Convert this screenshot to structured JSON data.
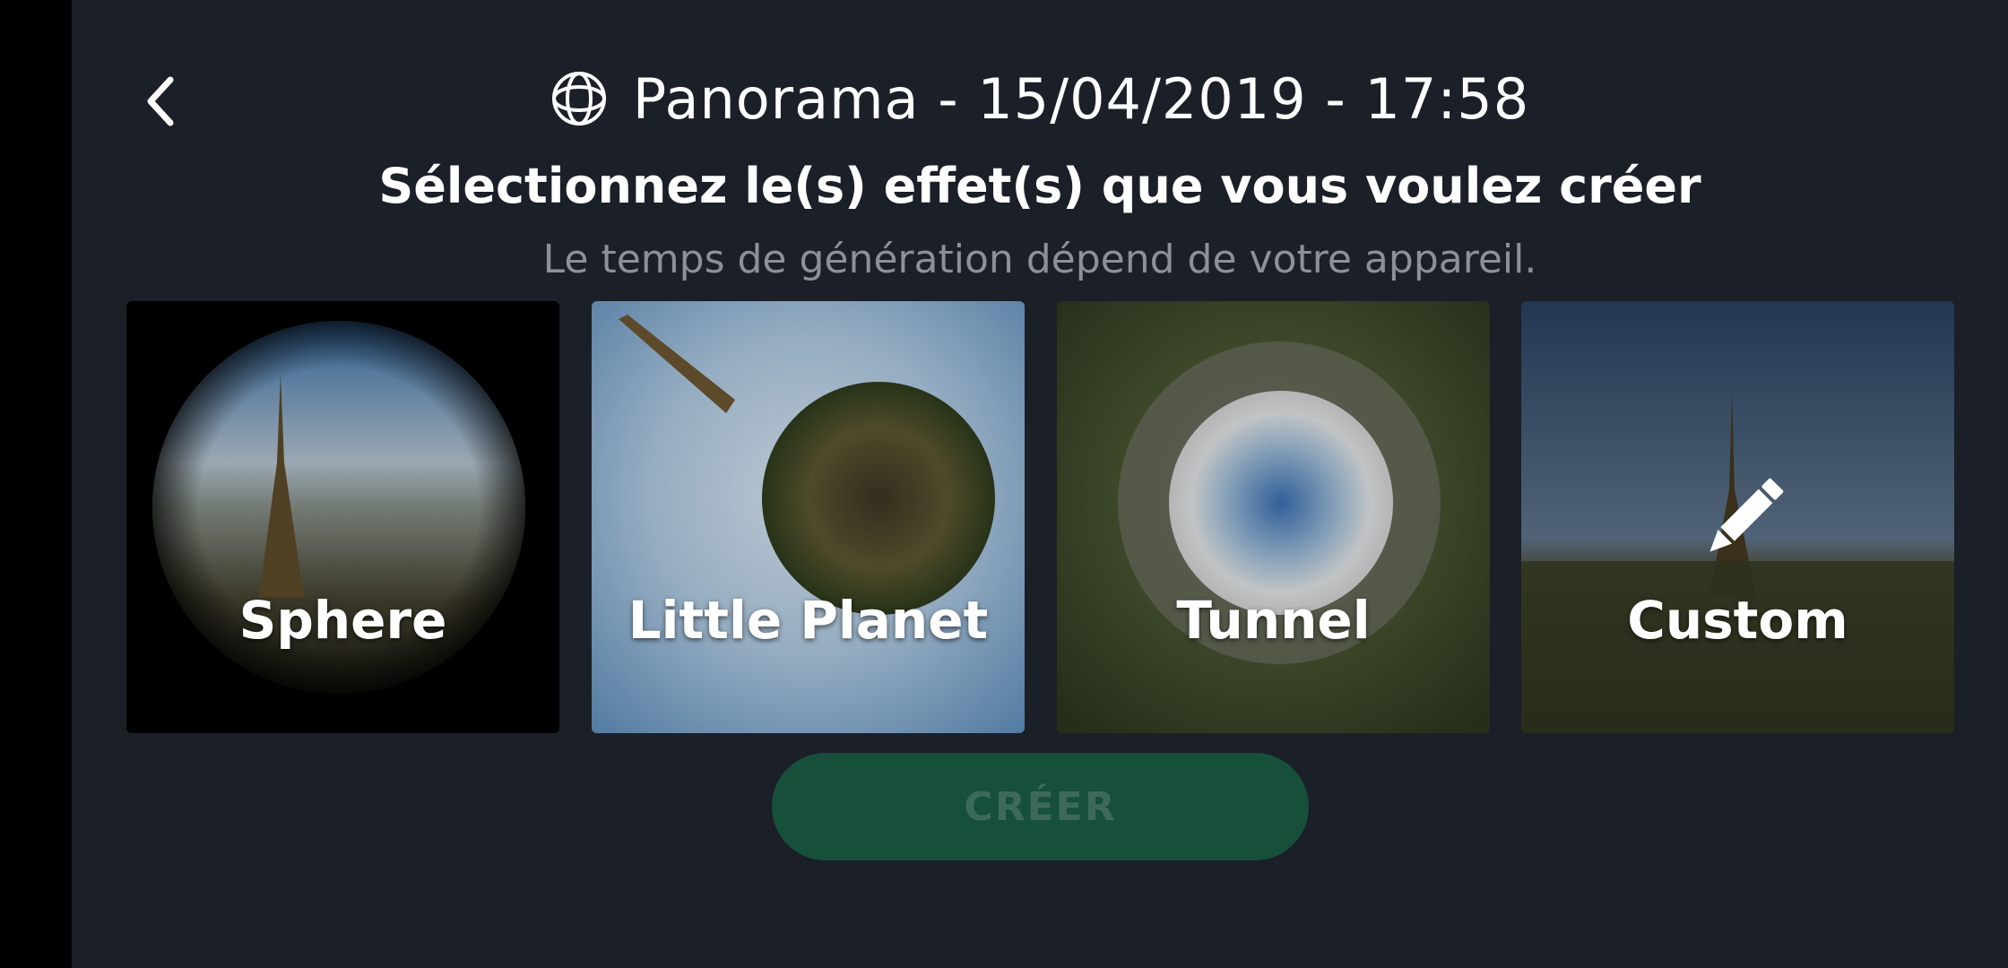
{
  "header": {
    "title": "Panorama - 15/04/2019 - 17:58",
    "back_icon": "chevron-left-icon",
    "title_icon": "globe-icon"
  },
  "heading": "Sélectionnez le(s) effet(s) que vous voulez créer",
  "subheading": "Le temps de génération dépend de votre appareil.",
  "effects": [
    {
      "label": "Sphere"
    },
    {
      "label": "Little Planet"
    },
    {
      "label": "Tunnel"
    },
    {
      "label": "Custom",
      "icon": "pencil-icon"
    }
  ],
  "create_button": {
    "label": "CRÉER",
    "enabled": false
  },
  "colors": {
    "background": "#1b1f27",
    "button_bg": "#16503a",
    "button_text": "#3d6a57",
    "subtext": "#8c9199"
  }
}
